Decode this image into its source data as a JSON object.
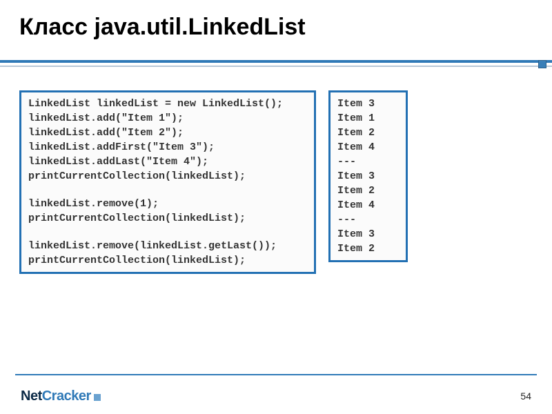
{
  "title": "Класс java.util.LinkedList",
  "code": {
    "lines": [
      "LinkedList linkedList = new LinkedList();",
      "linkedList.add(\"Item 1\");",
      "linkedList.add(\"Item 2\");",
      "linkedList.addFirst(\"Item 3\");",
      "linkedList.addLast(\"Item 4\");",
      "printCurrentCollection(linkedList);",
      "",
      "linkedList.remove(1);",
      "printCurrentCollection(linkedList);",
      "",
      "linkedList.remove(linkedList.getLast());",
      "printCurrentCollection(linkedList);"
    ]
  },
  "output": {
    "lines": [
      "Item 3",
      "Item 1",
      "Item 2",
      "Item 4",
      "---",
      "Item 3",
      "Item 2",
      "Item 4",
      "---",
      "Item 3",
      "Item 2"
    ]
  },
  "footer": {
    "logo_net": "Net",
    "logo_cracker": "Cracker",
    "page_number": "54"
  }
}
